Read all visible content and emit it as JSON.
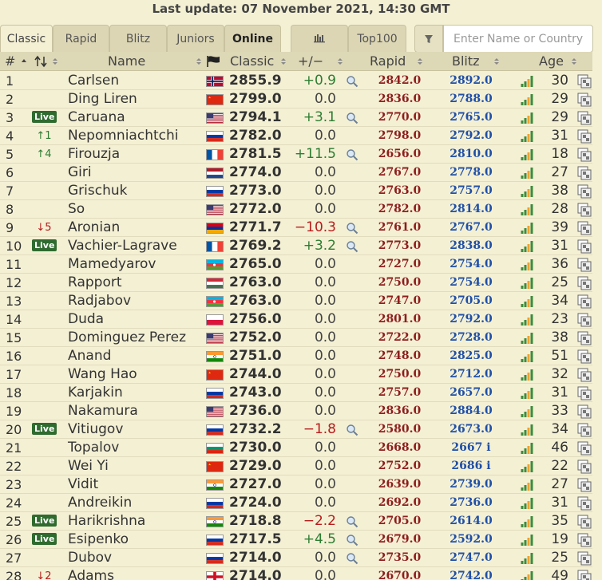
{
  "header": {
    "last_update": "Last update: 07 November 2021, 14:30 GMT"
  },
  "tabs": [
    {
      "label": "Classic",
      "active": true
    },
    {
      "label": "Rapid"
    },
    {
      "label": "Blitz"
    },
    {
      "label": "Juniors"
    },
    {
      "label": "Online",
      "bold": true
    }
  ],
  "top100_label": "Top100",
  "search": {
    "placeholder": "Enter Name or Country",
    "value": ""
  },
  "columns": {
    "rank": "#",
    "name": "Name",
    "classic": "Classic",
    "delta": "+/−",
    "rapid": "Rapid",
    "blitz": "Blitz",
    "age": "Age"
  },
  "colors": {
    "background": "#f4f0d4",
    "header": "#ddd8b6",
    "positive": "#2e7d32",
    "negative": "#b71c1c",
    "rapid": "#8e1d1d",
    "blitz": "#1f4fa8",
    "live_badge": "#2f6b2f"
  },
  "players": [
    {
      "rank": "1",
      "change": "",
      "name": "Carlsen",
      "flag": "NO",
      "classic": "2855.9",
      "delta": "+0.9",
      "delta_type": "pos",
      "search": true,
      "rapid": "2842.0",
      "blitz": "2892.0",
      "age": "30"
    },
    {
      "rank": "2",
      "change": "",
      "name": "Ding Liren",
      "flag": "CN",
      "classic": "2799.0",
      "delta": "0.0",
      "delta_type": "zero",
      "search": false,
      "rapid": "2836.0",
      "blitz": "2788.0",
      "age": "29"
    },
    {
      "rank": "3",
      "change": "Live",
      "name": "Caruana",
      "flag": "US",
      "classic": "2794.1",
      "delta": "+3.1",
      "delta_type": "pos",
      "search": true,
      "rapid": "2770.0",
      "blitz": "2765.0",
      "age": "29"
    },
    {
      "rank": "4",
      "change": "↑1",
      "change_type": "up",
      "name": "Nepomniachtchi",
      "flag": "RU",
      "classic": "2782.0",
      "delta": "0.0",
      "delta_type": "zero",
      "search": false,
      "rapid": "2798.0",
      "blitz": "2792.0",
      "age": "31"
    },
    {
      "rank": "5",
      "change": "↑4",
      "change_type": "up",
      "name": "Firouzja",
      "flag": "FR",
      "classic": "2781.5",
      "delta": "+11.5",
      "delta_type": "pos",
      "search": true,
      "rapid": "2656.0",
      "blitz": "2810.0",
      "age": "18"
    },
    {
      "rank": "6",
      "change": "",
      "name": "Giri",
      "flag": "NL",
      "classic": "2774.0",
      "delta": "0.0",
      "delta_type": "zero",
      "search": false,
      "rapid": "2767.0",
      "blitz": "2778.0",
      "age": "27"
    },
    {
      "rank": "7",
      "change": "",
      "name": "Grischuk",
      "flag": "RU",
      "classic": "2773.0",
      "delta": "0.0",
      "delta_type": "zero",
      "search": false,
      "rapid": "2763.0",
      "blitz": "2757.0",
      "age": "38"
    },
    {
      "rank": "8",
      "change": "",
      "name": "So",
      "flag": "US",
      "classic": "2772.0",
      "delta": "0.0",
      "delta_type": "zero",
      "search": false,
      "rapid": "2782.0",
      "blitz": "2814.0",
      "age": "28"
    },
    {
      "rank": "9",
      "change": "↓5",
      "change_type": "down",
      "name": "Aronian",
      "flag": "AM",
      "classic": "2771.7",
      "delta": "−10.3",
      "delta_type": "neg",
      "search": true,
      "rapid": "2761.0",
      "blitz": "2767.0",
      "age": "39"
    },
    {
      "rank": "10",
      "change": "Live",
      "name": "Vachier-Lagrave",
      "flag": "FR",
      "classic": "2769.2",
      "delta": "+3.2",
      "delta_type": "pos",
      "search": true,
      "rapid": "2773.0",
      "blitz": "2838.0",
      "age": "31"
    },
    {
      "rank": "11",
      "change": "",
      "name": "Mamedyarov",
      "flag": "AZ",
      "classic": "2765.0",
      "delta": "0.0",
      "delta_type": "zero",
      "search": false,
      "rapid": "2727.0",
      "blitz": "2754.0",
      "age": "36"
    },
    {
      "rank": "12",
      "change": "",
      "name": "Rapport",
      "flag": "HU",
      "classic": "2763.0",
      "delta": "0.0",
      "delta_type": "zero",
      "search": false,
      "rapid": "2750.0",
      "blitz": "2754.0",
      "age": "25"
    },
    {
      "rank": "13",
      "change": "",
      "name": "Radjabov",
      "flag": "AZ",
      "classic": "2763.0",
      "delta": "0.0",
      "delta_type": "zero",
      "search": false,
      "rapid": "2747.0",
      "blitz": "2705.0",
      "age": "34"
    },
    {
      "rank": "14",
      "change": "",
      "name": "Duda",
      "flag": "PL",
      "classic": "2756.0",
      "delta": "0.0",
      "delta_type": "zero",
      "search": false,
      "rapid": "2801.0",
      "blitz": "2792.0",
      "age": "23"
    },
    {
      "rank": "15",
      "change": "",
      "name": "Dominguez Perez",
      "flag": "US",
      "classic": "2752.0",
      "delta": "0.0",
      "delta_type": "zero",
      "search": false,
      "rapid": "2722.0",
      "blitz": "2728.0",
      "age": "38"
    },
    {
      "rank": "16",
      "change": "",
      "name": "Anand",
      "flag": "IN",
      "classic": "2751.0",
      "delta": "0.0",
      "delta_type": "zero",
      "search": false,
      "rapid": "2748.0",
      "blitz": "2825.0",
      "age": "51"
    },
    {
      "rank": "17",
      "change": "",
      "name": "Wang Hao",
      "flag": "CN",
      "classic": "2744.0",
      "delta": "0.0",
      "delta_type": "zero",
      "search": false,
      "rapid": "2750.0",
      "blitz": "2712.0",
      "age": "32"
    },
    {
      "rank": "18",
      "change": "",
      "name": "Karjakin",
      "flag": "RU",
      "classic": "2743.0",
      "delta": "0.0",
      "delta_type": "zero",
      "search": false,
      "rapid": "2757.0",
      "blitz": "2657.0",
      "age": "31"
    },
    {
      "rank": "19",
      "change": "",
      "name": "Nakamura",
      "flag": "US",
      "classic": "2736.0",
      "delta": "0.0",
      "delta_type": "zero",
      "search": false,
      "rapid": "2836.0",
      "blitz": "2884.0",
      "age": "33"
    },
    {
      "rank": "20",
      "change": "Live",
      "name": "Vitiugov",
      "flag": "RU",
      "classic": "2732.2",
      "delta": "−1.8",
      "delta_type": "neg",
      "search": true,
      "rapid": "2580.0",
      "blitz": "2673.0",
      "age": "34"
    },
    {
      "rank": "21",
      "change": "",
      "name": "Topalov",
      "flag": "BG",
      "classic": "2730.0",
      "delta": "0.0",
      "delta_type": "zero",
      "search": false,
      "rapid": "2668.0",
      "blitz": "2667 i",
      "age": "46"
    },
    {
      "rank": "22",
      "change": "",
      "name": "Wei Yi",
      "flag": "CN",
      "classic": "2729.0",
      "delta": "0.0",
      "delta_type": "zero",
      "search": false,
      "rapid": "2752.0",
      "blitz": "2686 i",
      "age": "22"
    },
    {
      "rank": "23",
      "change": "",
      "name": "Vidit",
      "flag": "IN",
      "classic": "2727.0",
      "delta": "0.0",
      "delta_type": "zero",
      "search": false,
      "rapid": "2639.0",
      "blitz": "2739.0",
      "age": "27"
    },
    {
      "rank": "24",
      "change": "",
      "name": "Andreikin",
      "flag": "RU",
      "classic": "2724.0",
      "delta": "0.0",
      "delta_type": "zero",
      "search": false,
      "rapid": "2692.0",
      "blitz": "2736.0",
      "age": "31"
    },
    {
      "rank": "25",
      "change": "Live",
      "name": "Harikrishna",
      "flag": "IN",
      "classic": "2718.8",
      "delta": "−2.2",
      "delta_type": "neg",
      "search": true,
      "rapid": "2705.0",
      "blitz": "2614.0",
      "age": "35"
    },
    {
      "rank": "26",
      "change": "Live",
      "name": "Esipenko",
      "flag": "RU",
      "classic": "2717.5",
      "delta": "+4.5",
      "delta_type": "pos",
      "search": true,
      "rapid": "2679.0",
      "blitz": "2592.0",
      "age": "19"
    },
    {
      "rank": "27",
      "change": "",
      "name": "Dubov",
      "flag": "RU",
      "classic": "2714.0",
      "delta": "0.0",
      "delta_type": "zero",
      "search": true,
      "rapid": "2735.0",
      "blitz": "2747.0",
      "age": "25"
    },
    {
      "rank": "28",
      "change": "↓2",
      "change_type": "down",
      "name": "Adams",
      "flag": "GB-ENG",
      "classic": "2714.0",
      "delta": "0.0",
      "delta_type": "zero",
      "search": false,
      "rapid": "2670.0",
      "blitz": "2742.0",
      "age": "49"
    }
  ]
}
